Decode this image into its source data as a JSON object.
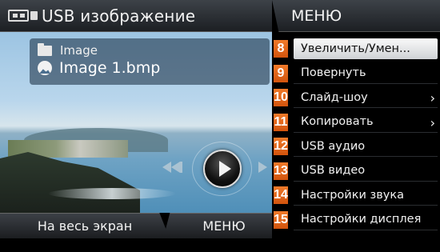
{
  "header": {
    "title": "USB изображение",
    "usb_icon": "usb-drive-icon"
  },
  "viewer": {
    "folder_name": "Image",
    "file_name": "Image 1.bmp",
    "controls": {
      "prev_icon": "previous-icon",
      "play_icon": "play-icon",
      "next_icon": "next-icon"
    }
  },
  "bottom_bar": {
    "fullscreen_label": "На весь экран",
    "menu_label": "МЕНЮ"
  },
  "menu": {
    "title": "МЕНЮ",
    "items": [
      {
        "num": "8",
        "label": "Увеличить/Умен...",
        "selected": true,
        "has_submenu": false
      },
      {
        "num": "9",
        "label": "Повернуть",
        "selected": false,
        "has_submenu": false
      },
      {
        "num": "10",
        "label": "Слайд-шоу",
        "selected": false,
        "has_submenu": true
      },
      {
        "num": "11",
        "label": "Копировать",
        "selected": false,
        "has_submenu": true
      },
      {
        "num": "12",
        "label": "USB аудио",
        "selected": false,
        "has_submenu": false
      },
      {
        "num": "13",
        "label": "USB видео",
        "selected": false,
        "has_submenu": false
      },
      {
        "num": "14",
        "label": "Настройки звука",
        "selected": false,
        "has_submenu": false
      },
      {
        "num": "15",
        "label": "Настройки дисплея",
        "selected": false,
        "has_submenu": false
      }
    ],
    "submenu_arrow": "›"
  },
  "colors": {
    "badge": "#e8651c",
    "selected_row": "#e6e8ea",
    "bar_dark": "#1c1f23"
  }
}
